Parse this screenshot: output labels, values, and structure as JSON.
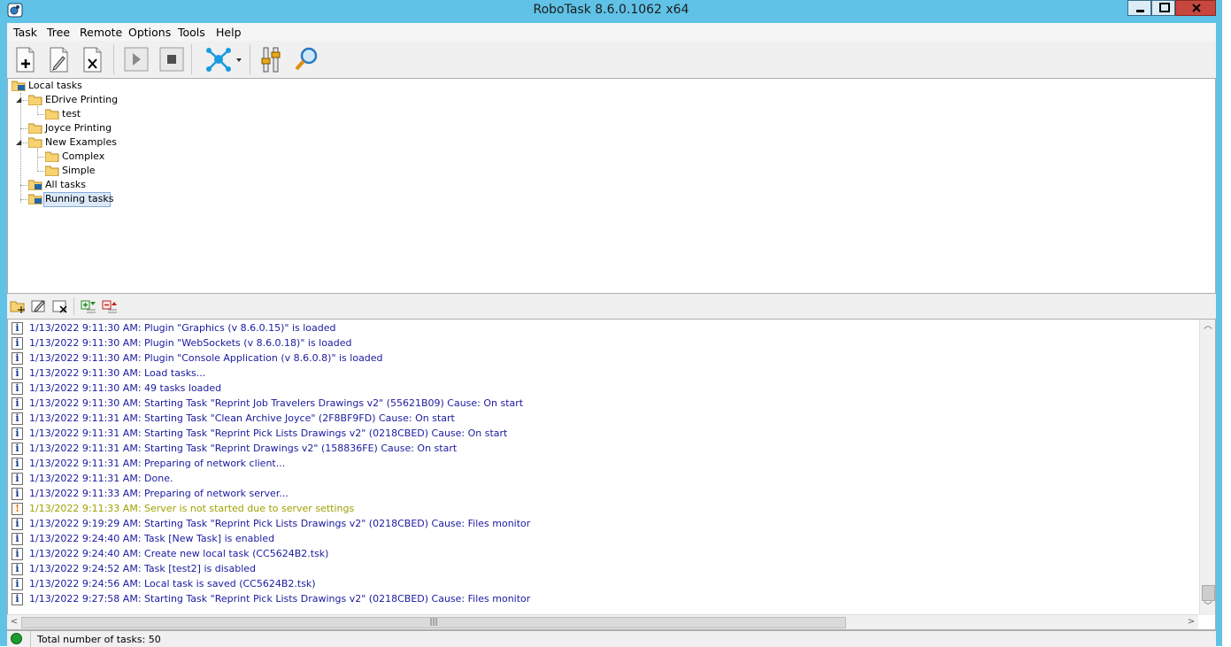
{
  "window": {
    "title": "RoboTask 8.6.0.1062 x64"
  },
  "menu": [
    "Task",
    "Tree",
    "Remote",
    "Options",
    "Tools",
    "Help"
  ],
  "toolbar": {
    "buttons": [
      "new-task",
      "edit-task",
      "delete-task",
      "run-task",
      "stop-task",
      "network",
      "options",
      "search"
    ]
  },
  "tree": {
    "root": "Local tasks",
    "nodes": [
      {
        "label": "EDrive Printing",
        "level": 1,
        "expanded": true
      },
      {
        "label": "test",
        "level": 2
      },
      {
        "label": "Joyce Printing",
        "level": 1
      },
      {
        "label": "New Examples",
        "level": 1,
        "expanded": true
      },
      {
        "label": "Complex",
        "level": 2
      },
      {
        "label": "Simple",
        "level": 2
      },
      {
        "label": "All tasks",
        "level": 1
      },
      {
        "label": "Running tasks",
        "level": 1,
        "selected": true
      }
    ]
  },
  "log_toolbar": {
    "buttons": [
      "add-group",
      "edit-group",
      "delete-group",
      "expand-all",
      "collapse-all"
    ]
  },
  "log": {
    "entries": [
      {
        "type": "info",
        "text": "1/13/2022 9:11:30 AM: Plugin \"Graphics (v 8.6.0.15)\" is loaded"
      },
      {
        "type": "info",
        "text": "1/13/2022 9:11:30 AM: Plugin \"WebSockets (v 8.6.0.18)\" is loaded"
      },
      {
        "type": "info",
        "text": "1/13/2022 9:11:30 AM: Plugin \"Console Application (v 8.6.0.8)\" is loaded"
      },
      {
        "type": "info",
        "text": "1/13/2022 9:11:30 AM: Load tasks..."
      },
      {
        "type": "info",
        "text": "1/13/2022 9:11:30 AM: 49 tasks loaded"
      },
      {
        "type": "info",
        "text": "1/13/2022 9:11:30 AM: Starting Task \"Reprint Job Travelers Drawings v2\" (55621B09) Cause: On start"
      },
      {
        "type": "info",
        "text": "1/13/2022 9:11:31 AM: Starting Task \"Clean Archive Joyce\" (2F8BF9FD) Cause: On start"
      },
      {
        "type": "info",
        "text": "1/13/2022 9:11:31 AM: Starting Task \"Reprint Pick Lists Drawings v2\" (0218CBED) Cause: On start"
      },
      {
        "type": "info",
        "text": "1/13/2022 9:11:31 AM: Starting Task \"Reprint Drawings v2\" (158836FE) Cause: On start"
      },
      {
        "type": "info",
        "text": "1/13/2022 9:11:31 AM: Preparing of network client..."
      },
      {
        "type": "info",
        "text": "1/13/2022 9:11:31 AM: Done."
      },
      {
        "type": "info",
        "text": "1/13/2022 9:11:33 AM: Preparing of network server..."
      },
      {
        "type": "warning",
        "text": "1/13/2022 9:11:33 AM: Server is not started due to server settings"
      },
      {
        "type": "info",
        "text": "1/13/2022 9:19:29 AM: Starting Task \"Reprint Pick Lists Drawings v2\" (0218CBED) Cause: Files monitor"
      },
      {
        "type": "info",
        "text": "1/13/2022 9:24:40 AM: Task [New Task] is enabled"
      },
      {
        "type": "info",
        "text": "1/13/2022 9:24:40 AM: Create new local task (CC5624B2.tsk)"
      },
      {
        "type": "info",
        "text": "1/13/2022 9:24:52 AM: Task [test2] is disabled"
      },
      {
        "type": "info",
        "text": "1/13/2022 9:24:56 AM: Local task is saved (CC5624B2.tsk)"
      },
      {
        "type": "info",
        "text": "1/13/2022 9:27:58 AM: Starting Task \"Reprint Pick Lists Drawings v2\" (0218CBED) Cause: Files monitor"
      }
    ],
    "icon_info": "i",
    "icon_warning": "!"
  },
  "status": {
    "text": "Total number of tasks: 50"
  },
  "colors": {
    "frame": "#5fc2e6",
    "log_info": "#1a1aa0",
    "log_warning": "#a0a000",
    "status_ok": "#1a9c2e"
  }
}
